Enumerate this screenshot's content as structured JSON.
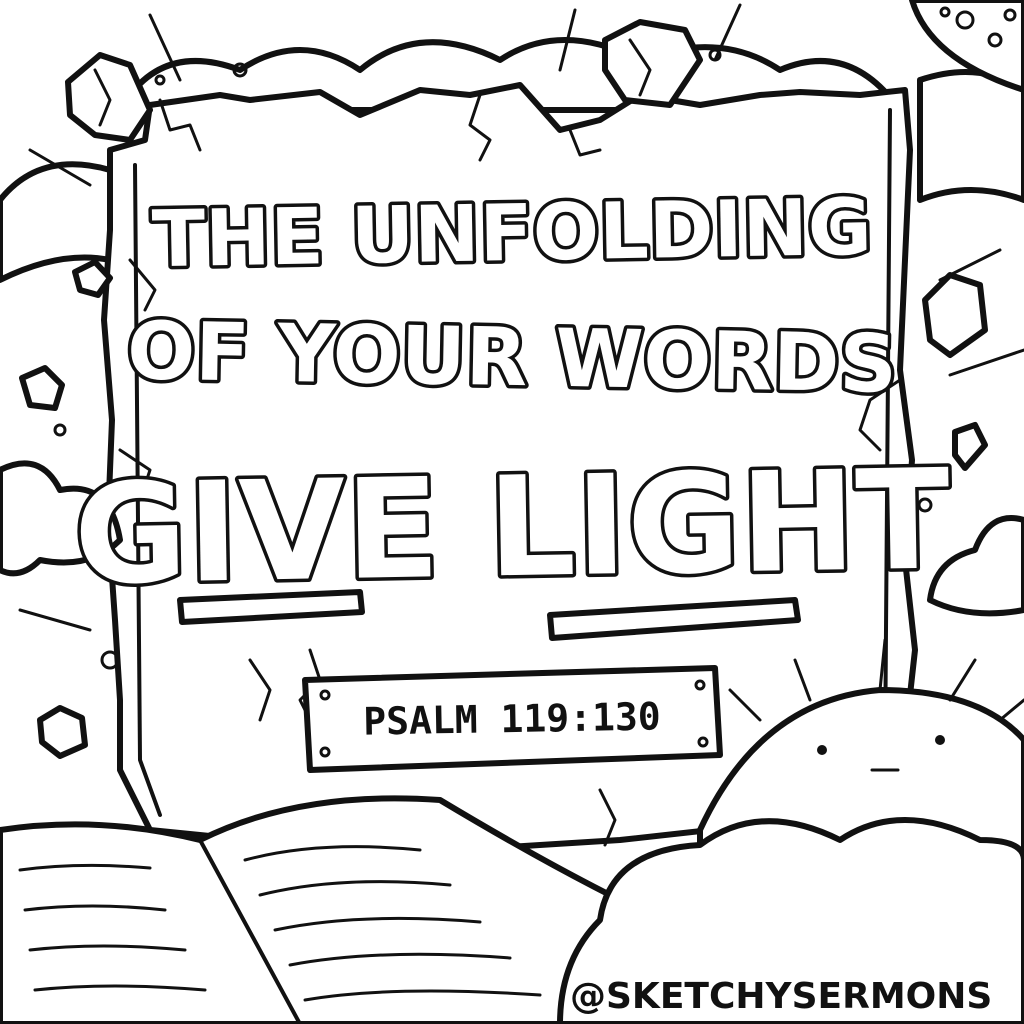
{
  "title": {
    "line1": "THE UNFOLDING",
    "line2": "OF YOUR WORDS",
    "line3": "GIVE LIGHT"
  },
  "reference": "PSALM 119:130",
  "credit": "@SKETCHYSERMONS"
}
